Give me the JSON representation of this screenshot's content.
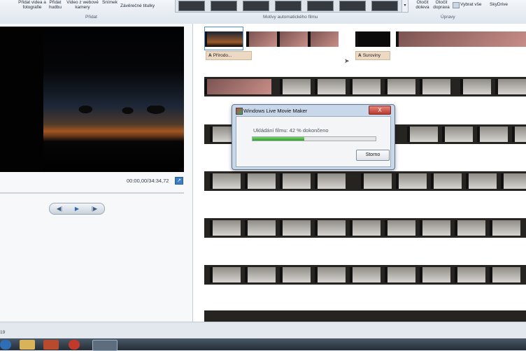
{
  "ribbon": {
    "add_video_photos": "Přidat videa a fotografie",
    "add_music": "Přidat hudbu",
    "webcam_video": "Video z webové kamery",
    "snapshot": "Snímek",
    "credits": "Závěrečné titulky",
    "add_group": "Přidat",
    "themes_group": "Motivy automatického filmu",
    "rotate_left": "Otočit doleva",
    "rotate_right": "Otočit doprava",
    "select_all": "Vybrat vše",
    "edit_group": "Úpravy",
    "skydrive": "SkyDrive"
  },
  "player": {
    "timecode": "00:00,00/34:34,72"
  },
  "storyboard": {
    "caption1": "Přírodo...",
    "caption2": "Suroviny",
    "caption_icon": "A"
  },
  "dialog": {
    "title": "Windows Live Movie Maker",
    "close": "X",
    "message": "Ukládání filmu: 42 % dokončeno",
    "progress": 0.42,
    "cancel": "Storno"
  },
  "status": {
    "left_num": "19"
  },
  "colors": {
    "progress_green": "#2e9c2a",
    "dialog_frame": "#c8d8ea",
    "close_red": "#b93b2e"
  }
}
